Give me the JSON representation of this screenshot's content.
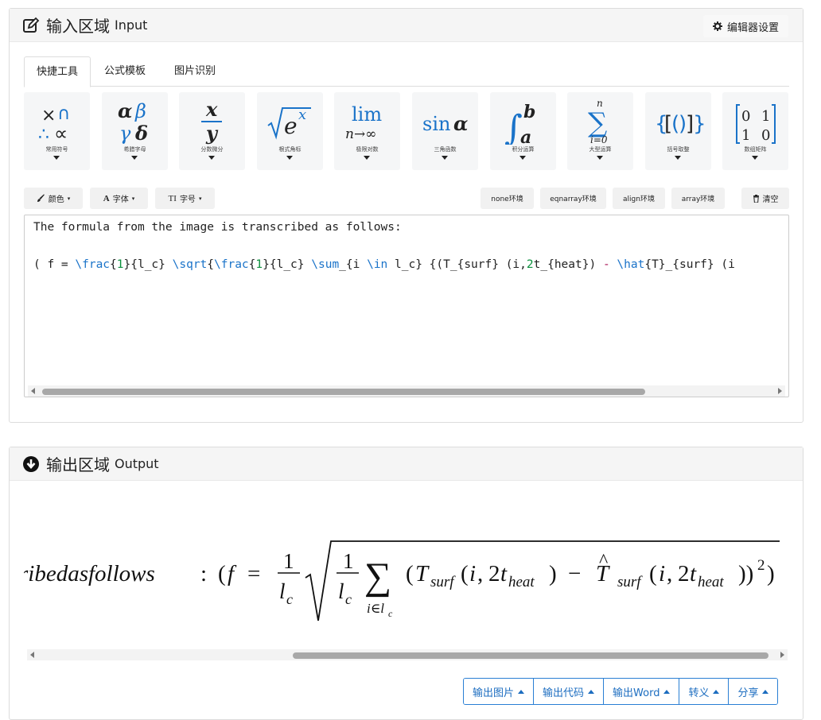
{
  "input": {
    "title": "输入区域",
    "subtitle": "Input",
    "settings_label": "编辑器设置"
  },
  "tabs": [
    {
      "label": "快捷工具",
      "active": true
    },
    {
      "label": "公式模板",
      "active": false
    },
    {
      "label": "图片识别",
      "active": false
    }
  ],
  "tools": [
    {
      "label": "常用符号",
      "icon": "common-symbols-icon"
    },
    {
      "label": "希腊字母",
      "icon": "greek-letters-icon"
    },
    {
      "label": "分数微分",
      "icon": "fraction-icon"
    },
    {
      "label": "根式角标",
      "icon": "radical-icon"
    },
    {
      "label": "极限对数",
      "icon": "limit-icon"
    },
    {
      "label": "三角函数",
      "icon": "trig-icon"
    },
    {
      "label": "积分运算",
      "icon": "integral-icon"
    },
    {
      "label": "大型运算",
      "icon": "sum-icon"
    },
    {
      "label": "括号取整",
      "icon": "brackets-icon"
    },
    {
      "label": "数组矩阵",
      "icon": "matrix-icon"
    }
  ],
  "format_buttons": {
    "color": "颜色",
    "font": "字体",
    "size": "字号"
  },
  "env_buttons": {
    "none": "none环境",
    "eqnarray": "eqnarray环境",
    "align": "align环境",
    "array": "array环境",
    "clear": "清空"
  },
  "editor": {
    "line1": "The formula from the image is transcribed as follows:"
  },
  "output": {
    "title": "输出区域",
    "subtitle": "Output",
    "math_prefix": "ribedasfollows"
  },
  "output_buttons": [
    {
      "label": "输出图片"
    },
    {
      "label": "输出代码"
    },
    {
      "label": "输出Word"
    },
    {
      "label": "转义"
    },
    {
      "label": "分享"
    }
  ],
  "colors": {
    "accent": "#2a7fd4",
    "latex_command": "#1a73c9",
    "latex_number": "#0a8f3c",
    "math_blue": "#1a73c9"
  }
}
